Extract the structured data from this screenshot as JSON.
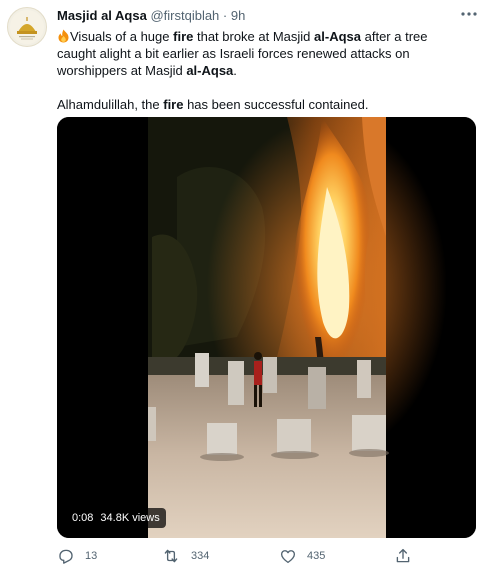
{
  "tweet": {
    "author_name": "Masjid al Aqsa",
    "handle": "@firstqiblah",
    "separator": "·",
    "time": "9h",
    "text": {
      "p1_a": "Visuals of a huge ",
      "p1_b": "fire",
      "p1_c": " that broke at Masjid ",
      "p1_d": "al-Aqsa",
      "p1_e": " after a tree caught alight a bit earlier as Israeli forces renewed attacks on worshippers at Masjid ",
      "p1_f": "al-Aqsa",
      "p1_g": ".",
      "p2_a": "Alhamdulillah, the ",
      "p2_b": "fire",
      "p2_c": " has been successful contained."
    },
    "video": {
      "duration": "0:08",
      "views": "34.8K views"
    },
    "actions": {
      "replies": "13",
      "retweets": "334",
      "likes": "435"
    }
  },
  "icons": [
    "avatar-dome-logo",
    "fire-emoji-icon",
    "more-icon",
    "reply-icon",
    "retweet-icon",
    "like-icon",
    "share-icon"
  ],
  "colors": {
    "name_text": "#0f1419",
    "secondary_text": "#536471",
    "video_bar": "#000000",
    "fire": "#f5a623"
  }
}
